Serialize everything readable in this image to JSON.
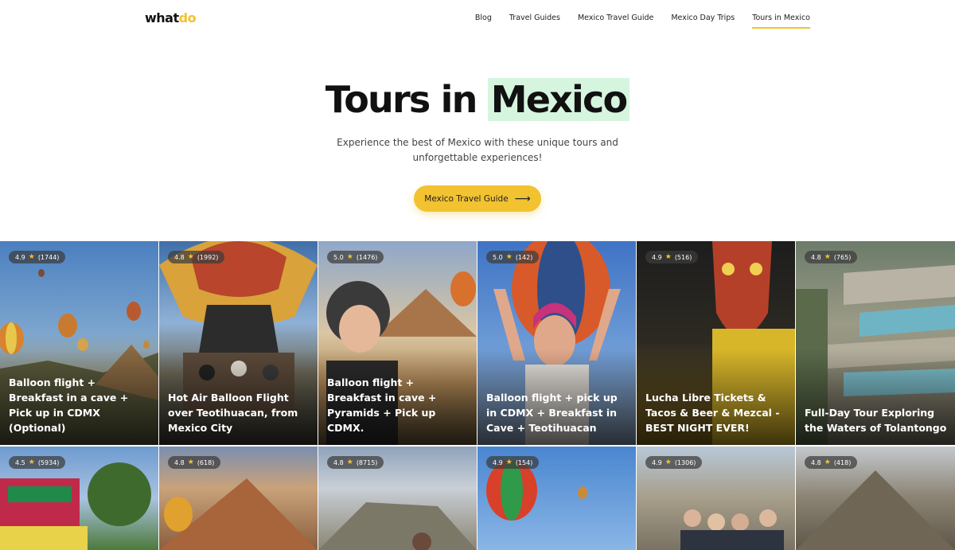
{
  "header": {
    "logo_a": "what",
    "logo_b": "do",
    "nav": [
      {
        "label": "Blog"
      },
      {
        "label": "Travel Guides"
      },
      {
        "label": "Mexico Travel Guide"
      },
      {
        "label": "Mexico Day Trips"
      },
      {
        "label": "Tours in Mexico",
        "active": true
      }
    ]
  },
  "hero": {
    "title_a": "Tours in ",
    "title_b": "Mexico",
    "subtitle": "Experience the best of Mexico with these unique tours and unforgettable experiences!",
    "cta_label": "Mexico Travel Guide",
    "cta_arrow": "⟶"
  },
  "colors": {
    "accent": "#f2c230",
    "highlight": "#d6f5df"
  },
  "tours": [
    {
      "rating": "4.9",
      "reviews": "(1744)",
      "title": "Balloon flight + Breakfast in a cave + Pick up in CDMX (Optional)"
    },
    {
      "rating": "4.8",
      "reviews": "(1992)",
      "title": "Hot Air Balloon Flight over Teotihuacan, from Mexico City"
    },
    {
      "rating": "5.0",
      "reviews": "(1476)",
      "title": "Balloon flight + Breakfast in cave + Pyramids + Pick up CDMX."
    },
    {
      "rating": "5.0",
      "reviews": "(142)",
      "title": "Balloon flight + pick up in CDMX + Breakfast in Cave + Teotihuacan"
    },
    {
      "rating": "4.9",
      "reviews": "(516)",
      "title": "Lucha Libre Tickets & Tacos & Beer & Mezcal - BEST NIGHT EVER!"
    },
    {
      "rating": "4.8",
      "reviews": "(765)",
      "title": "Full-Day Tour Exploring the Waters of Tolantongo"
    },
    {
      "rating": "4.5",
      "reviews": "(5934)",
      "title": ""
    },
    {
      "rating": "4.8",
      "reviews": "(618)",
      "title": ""
    },
    {
      "rating": "4.8",
      "reviews": "(8715)",
      "title": ""
    },
    {
      "rating": "4.9",
      "reviews": "(154)",
      "title": ""
    },
    {
      "rating": "4.9",
      "reviews": "(1306)",
      "title": ""
    },
    {
      "rating": "4.8",
      "reviews": "(418)",
      "title": ""
    }
  ]
}
